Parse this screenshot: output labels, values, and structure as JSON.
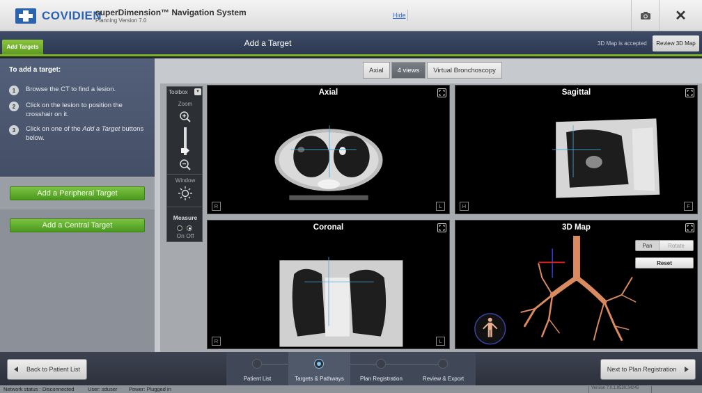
{
  "header": {
    "brand": "COVIDIEN",
    "app_title": "superDimension™ Navigation System",
    "app_version": "Planning Version 7.0",
    "hide_link": "Hide",
    "camera_icon": "camera-icon",
    "close_icon": "close-icon",
    "close_glyph": "✕"
  },
  "titlebar": {
    "active_tab": "Add Targets",
    "page_title": "Add a Target",
    "map_status": "3D Map is accepted",
    "review_button": "Review 3D Map"
  },
  "instructions": {
    "heading": "To add a target:",
    "steps": [
      {
        "num": "1",
        "text": "Browse the CT to find a lesion."
      },
      {
        "num": "2",
        "text": "Click on the lesion to position the crosshair on it."
      },
      {
        "num": "3",
        "text": "Click on one of the Add a Target buttons below."
      }
    ]
  },
  "actions": {
    "peripheral": "Add a Peripheral Target",
    "central": "Add a Central Target"
  },
  "view_tabs": [
    {
      "label": "Axial",
      "active": false
    },
    {
      "label": "4 views",
      "active": true
    },
    {
      "label": "Virtual Bronchoscopy",
      "active": false
    }
  ],
  "toolbox": {
    "title": "Toolbox",
    "toggle": "▾",
    "zoom_label": "Zoom",
    "zoom_level": 0.25,
    "window_label": "Window",
    "measure_label": "Measure",
    "measure_onoff": "On Off",
    "measure_selected": "Off"
  },
  "viewports": {
    "axial": {
      "title": "Axial",
      "left_corner": "R",
      "right_corner": "L"
    },
    "sagittal": {
      "title": "Sagittal",
      "left_corner": "H",
      "right_corner": "F"
    },
    "coronal": {
      "title": "Coronal",
      "left_corner": "R",
      "right_corner": "L"
    },
    "map3d": {
      "title": "3D Map",
      "pan": "Pan",
      "rotate": "Rotate",
      "reset": "Reset"
    }
  },
  "navigation": {
    "back": "Back to Patient List",
    "next": "Next to Plan Registration",
    "steps": [
      {
        "label": "Patient List",
        "state": "done"
      },
      {
        "label": "Targets & Pathways",
        "state": "current"
      },
      {
        "label": "Plan Registration",
        "state": "todo"
      },
      {
        "label": "Review & Export",
        "state": "todo"
      }
    ]
  },
  "status": {
    "network": "Network status : Disconnected",
    "user": "User:  sduser",
    "power": "Power:  Plugged in",
    "version": "Version 7.0.1.8530.34245"
  },
  "colors": {
    "accent_green": "#7ab32a",
    "brand_blue": "#2b63b0",
    "crosshair": "#4aa8d8"
  }
}
